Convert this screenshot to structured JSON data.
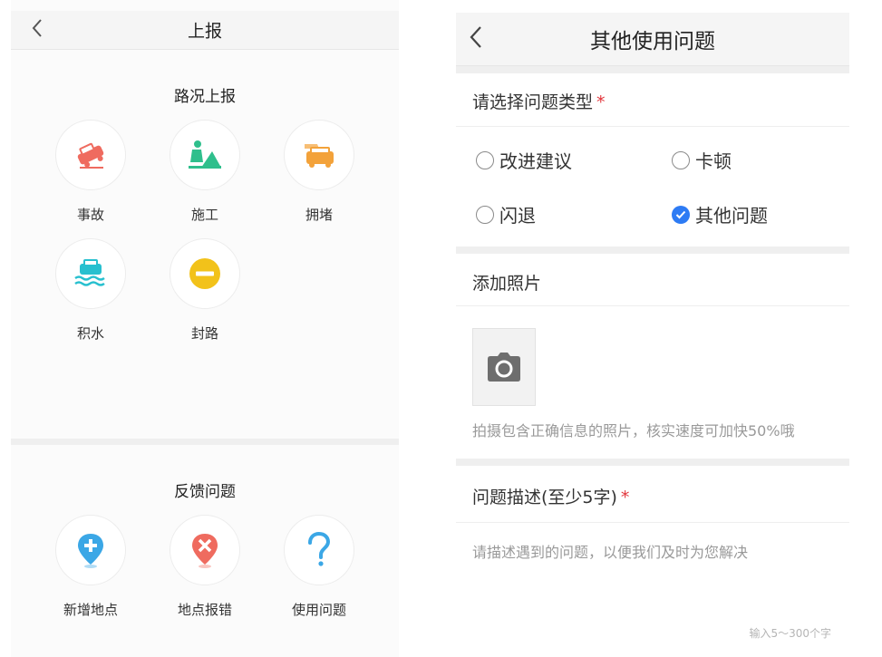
{
  "left_screen": {
    "title": "上报",
    "sections": {
      "road": {
        "title": "路况上报",
        "items": [
          {
            "label": "事故",
            "icon": "car-accident-icon",
            "color": "#ef6b5f"
          },
          {
            "label": "施工",
            "icon": "construction-icon",
            "color": "#2fbf8c"
          },
          {
            "label": "拥堵",
            "icon": "traffic-jam-icon",
            "color": "#f3a23a"
          },
          {
            "label": "积水",
            "icon": "flooding-icon",
            "color": "#28c0cf"
          },
          {
            "label": "封路",
            "icon": "road-closed-icon",
            "color": "#f2c21a"
          }
        ]
      },
      "feedback": {
        "title": "反馈问题",
        "items": [
          {
            "label": "新增地点",
            "icon": "add-location-icon",
            "color": "#3ba7e6"
          },
          {
            "label": "地点报错",
            "icon": "location-error-icon",
            "color": "#ef6b5f"
          },
          {
            "label": "使用问题",
            "icon": "question-icon",
            "color": "#3ba7e6"
          }
        ]
      }
    }
  },
  "right_screen": {
    "title": "其他使用问题",
    "type_label": "请选择问题类型",
    "required_mark": "*",
    "options": [
      {
        "label": "改进建议",
        "checked": false
      },
      {
        "label": "卡顿",
        "checked": false
      },
      {
        "label": "闪退",
        "checked": false
      },
      {
        "label": "其他问题",
        "checked": true
      }
    ],
    "photo_label": "添加照片",
    "photo_hint": "拍摄包含正确信息的照片，核实速度可加快50%哦",
    "desc_label": "问题描述(至少5字)",
    "desc_placeholder": "请描述遇到的问题，以便我们及时为您解决",
    "counter": "输入5～300个字"
  },
  "colors": {
    "accent": "#2d7bf4",
    "required": "#e2353b"
  }
}
